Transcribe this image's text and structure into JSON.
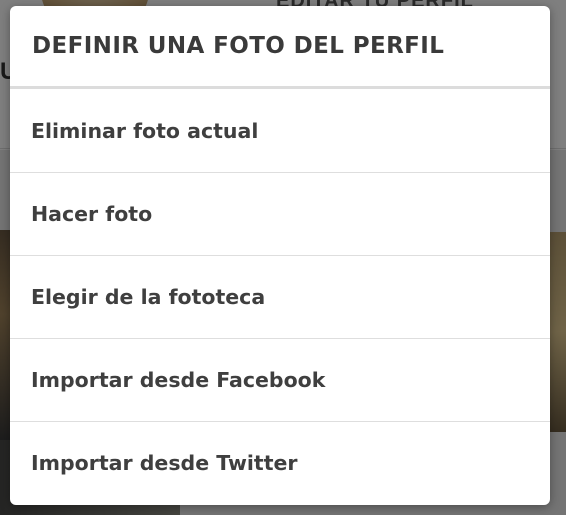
{
  "background": {
    "edit_profile_label": "EDITAR TU PERFIL"
  },
  "dialog": {
    "title": "DEFINIR UNA FOTO DEL PERFIL",
    "options": [
      {
        "label": "Eliminar foto actual"
      },
      {
        "label": "Hacer foto"
      },
      {
        "label": "Elegir de la fototeca"
      },
      {
        "label": "Importar desde Facebook"
      },
      {
        "label": "Importar desde Twitter"
      }
    ]
  },
  "colors": {
    "scrim": "#000000",
    "dialog_background": "#ffffff",
    "text": "#3f3f3f",
    "divider": "#dedede"
  }
}
